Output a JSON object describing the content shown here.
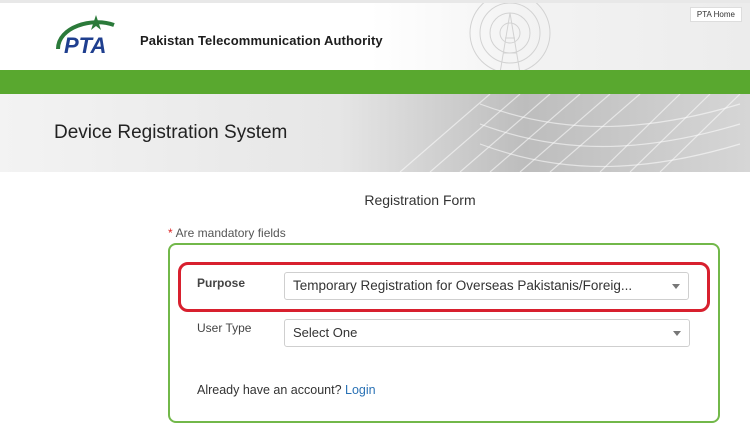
{
  "header": {
    "org_name": "Pakistan Telecommunication Authority",
    "logo_text": "PTA",
    "pta_home": "PTA Home"
  },
  "banner": {
    "title": "Device Registration System"
  },
  "form": {
    "title": "Registration Form",
    "mandatory_star": "*",
    "mandatory_text": "Are mandatory fields",
    "purpose_label": "Purpose",
    "purpose_value": "Temporary Registration for Overseas Pakistanis/Foreig...",
    "user_type_label": "User Type",
    "user_type_value": "Select One",
    "account_text": "Already have an account?",
    "login_link": "Login"
  },
  "colors": {
    "brand_green": "#59a82f",
    "form_border": "#72b84a",
    "highlight_red": "#d8202e",
    "link_blue": "#2a72b5"
  }
}
